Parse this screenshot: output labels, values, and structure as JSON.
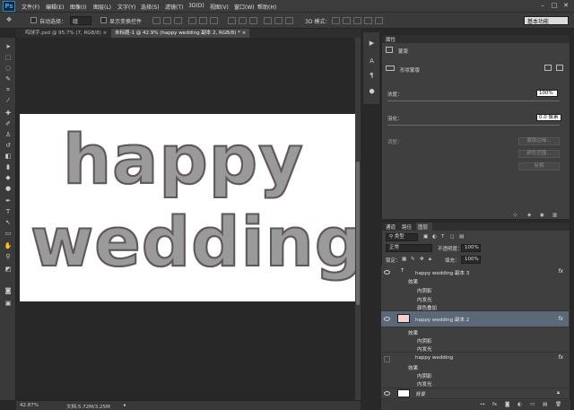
{
  "app": {
    "logo": "Ps"
  },
  "menu": [
    "文件(F)",
    "编辑(E)",
    "图像(I)",
    "图层(L)",
    "文字(Y)",
    "选择(S)",
    "滤镜(T)",
    "3D(D)",
    "视图(V)",
    "窗口(W)",
    "帮助(H)"
  ],
  "window_controls": {
    "minimize": "–",
    "maximize": "□",
    "close": "✕"
  },
  "options": {
    "auto_select_label": "自动选择：",
    "auto_select_value": "组",
    "show_transform_label": "显示变换控件",
    "mode_3d_label": "3D 模式：",
    "workspace": "基本功能"
  },
  "tabs": [
    {
      "label": "鸣球字.psd @ 95.7% (7, RGB/8)",
      "close": "×"
    },
    {
      "label": "未标题-1 @ 42.9% (happy wedding 副本 2, RGB/8) *",
      "close": "×"
    }
  ],
  "canvas": {
    "line1": "happy",
    "line2": "wedding"
  },
  "status": {
    "zoom": "42.87%",
    "doc": "文档:5.72M/3.25M"
  },
  "properties": {
    "title": "属性",
    "mask_label": "蒙版",
    "vector_mask_label": "形状蒙版",
    "density_label": "浓度：",
    "density_value": "100%",
    "feather_label": "羽化：",
    "feather_value": "0.0 像素",
    "adjust_label": "调整：",
    "btn_mask_edge": "蒙版边缘...",
    "btn_color_range": "颜色范围...",
    "btn_invert": "反相"
  },
  "layers_panel": {
    "tabs": [
      "通道",
      "路径",
      "图层"
    ],
    "kind_filter": "类型",
    "blend_mode": "正常",
    "opacity_label": "不透明度：",
    "opacity_value": "100%",
    "lock_label": "锁定：",
    "fill_label": "填充：",
    "fill_value": "100%",
    "layers": [
      {
        "name": "happy wedding 副本 3",
        "effects_label": "效果",
        "effects": [
          "内阴影",
          "内发光",
          "颜色叠加"
        ]
      },
      {
        "name": "happy wedding 副本 2",
        "effects_label": "效果",
        "effects": [
          "内阴影",
          "内发光"
        ]
      },
      {
        "name": "happy wedding",
        "effects_label": "效果",
        "effects": [
          "内阴影",
          "内发光"
        ]
      },
      {
        "name": "背景"
      }
    ]
  }
}
